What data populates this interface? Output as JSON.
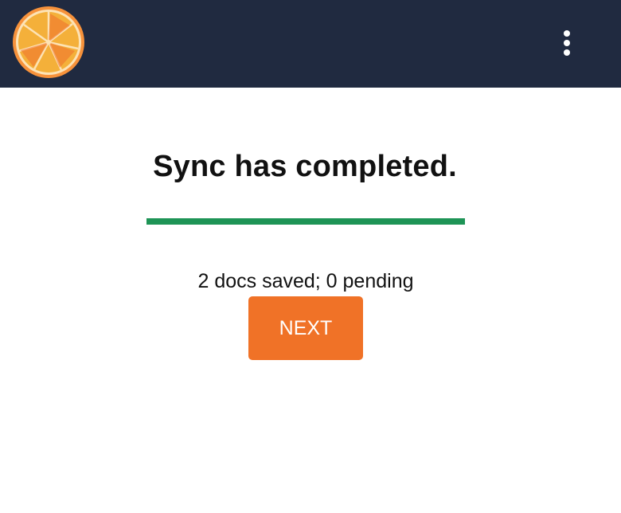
{
  "header": {
    "logo_name": "orange-slice-logo",
    "menu_icon": "more-vertical-icon"
  },
  "sync": {
    "title": "Sync has completed.",
    "progress": 1.0,
    "status": "2 docs saved; 0 pending"
  },
  "actions": {
    "next_label": "NEXT"
  },
  "colors": {
    "header_bg": "#202a40",
    "progress": "#1e9456",
    "button": "#f07227"
  }
}
